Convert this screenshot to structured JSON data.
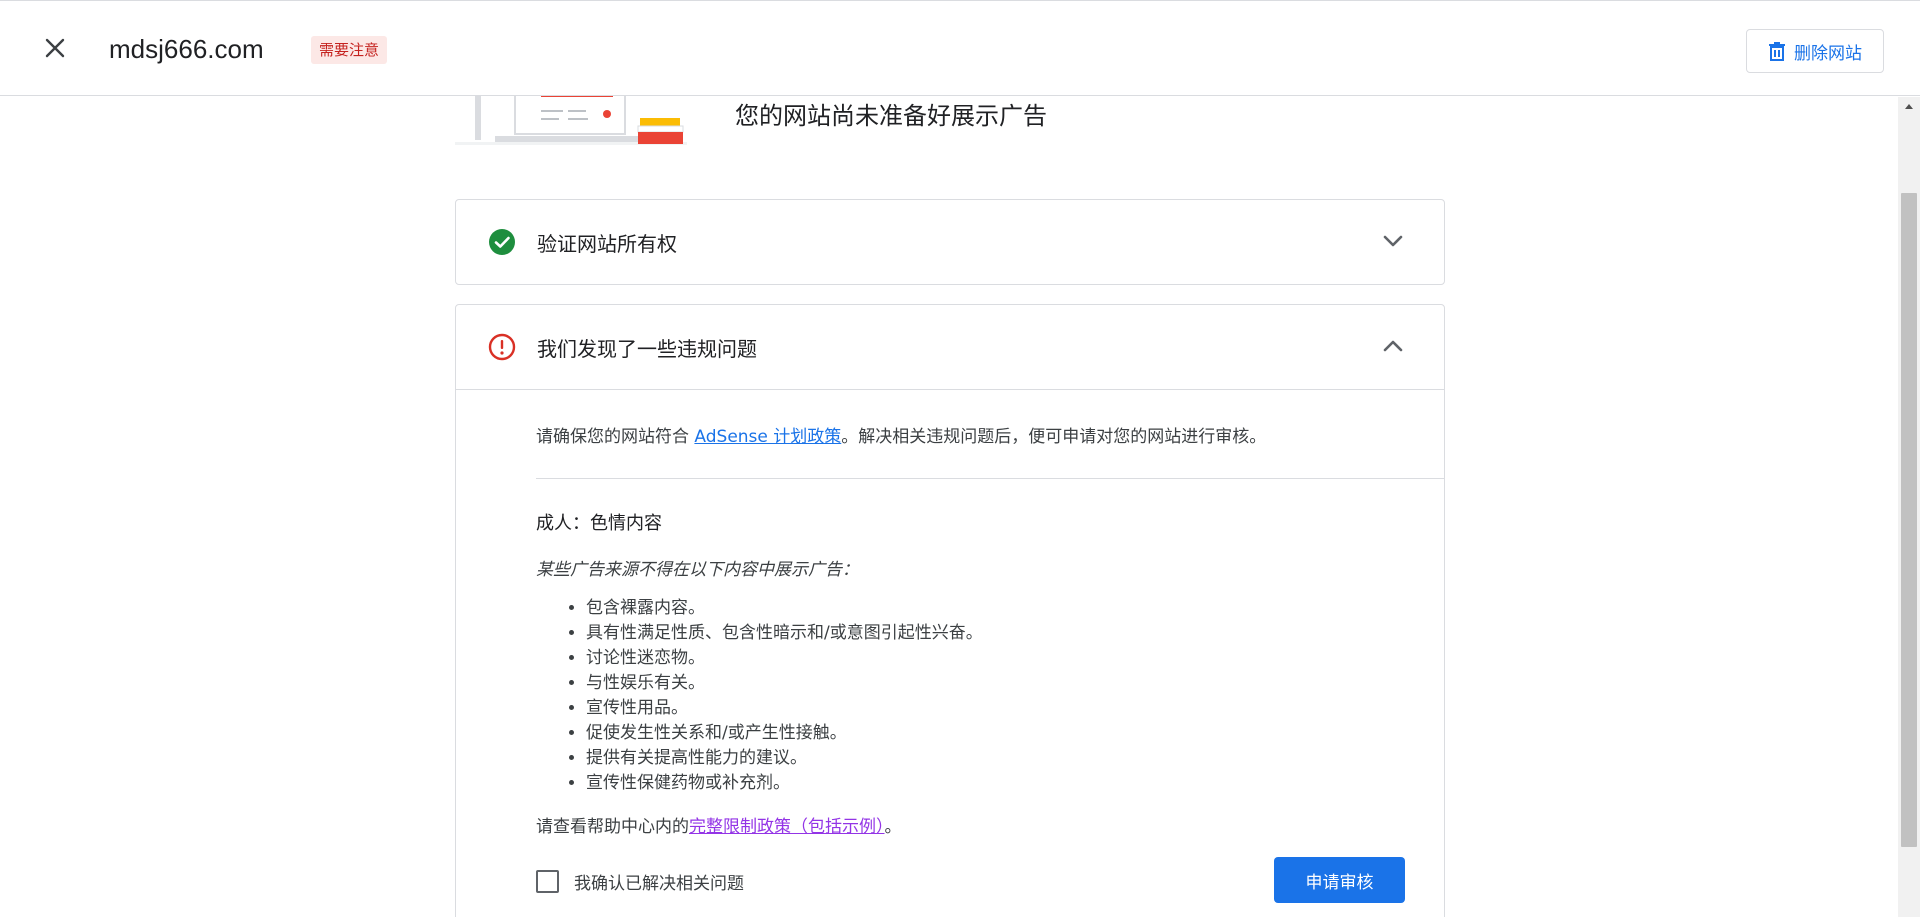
{
  "header": {
    "site_name": "mdsj666.com",
    "status_badge": "需要注意",
    "delete_label": "删除网站"
  },
  "hero": {
    "title": "您的网站尚未准备好展示广告"
  },
  "verify_panel": {
    "label": "验证网站所有权",
    "status": "complete",
    "expanded": false
  },
  "issues_panel": {
    "label": "我们发现了一些违规问题",
    "status": "error",
    "expanded": true,
    "intro_before": "请确保您的网站符合 ",
    "intro_link": "AdSense 计划政策",
    "intro_after": "。解决相关违规问题后，便可申请对您的网站进行审核。",
    "violation": {
      "title": "成人：色情内容",
      "note": "某些广告来源不得在以下内容中展示广告：",
      "items": [
        "包含裸露内容。",
        "具有性满足性质、包含性暗示和/或意图引起性兴奋。",
        "讨论性迷恋物。",
        "与性娱乐有关。",
        "宣传性用品。",
        "促使发生性关系和/或产生性接触。",
        "提供有关提高性能力的建议。",
        "宣传性保健药物或补充剂。"
      ]
    },
    "help_before": "请查看帮助中心内的",
    "help_link": "完整限制政策（包括示例）",
    "help_after": "。",
    "confirm_label": "我确认已解决相关问题",
    "confirm_checked": false,
    "apply_label": "申请审核"
  },
  "colors": {
    "accent": "#1a73e8",
    "success": "#1e8e3e",
    "error": "#d93025",
    "badge_bg": "#fce8e6",
    "visited_link": "#9334e6"
  },
  "icons": {
    "close": "close-icon",
    "delete": "trash-icon",
    "verified": "check-circle-icon",
    "issues": "error-circle-icon",
    "expand": "chevron-down-icon",
    "collapse": "chevron-up-icon"
  }
}
